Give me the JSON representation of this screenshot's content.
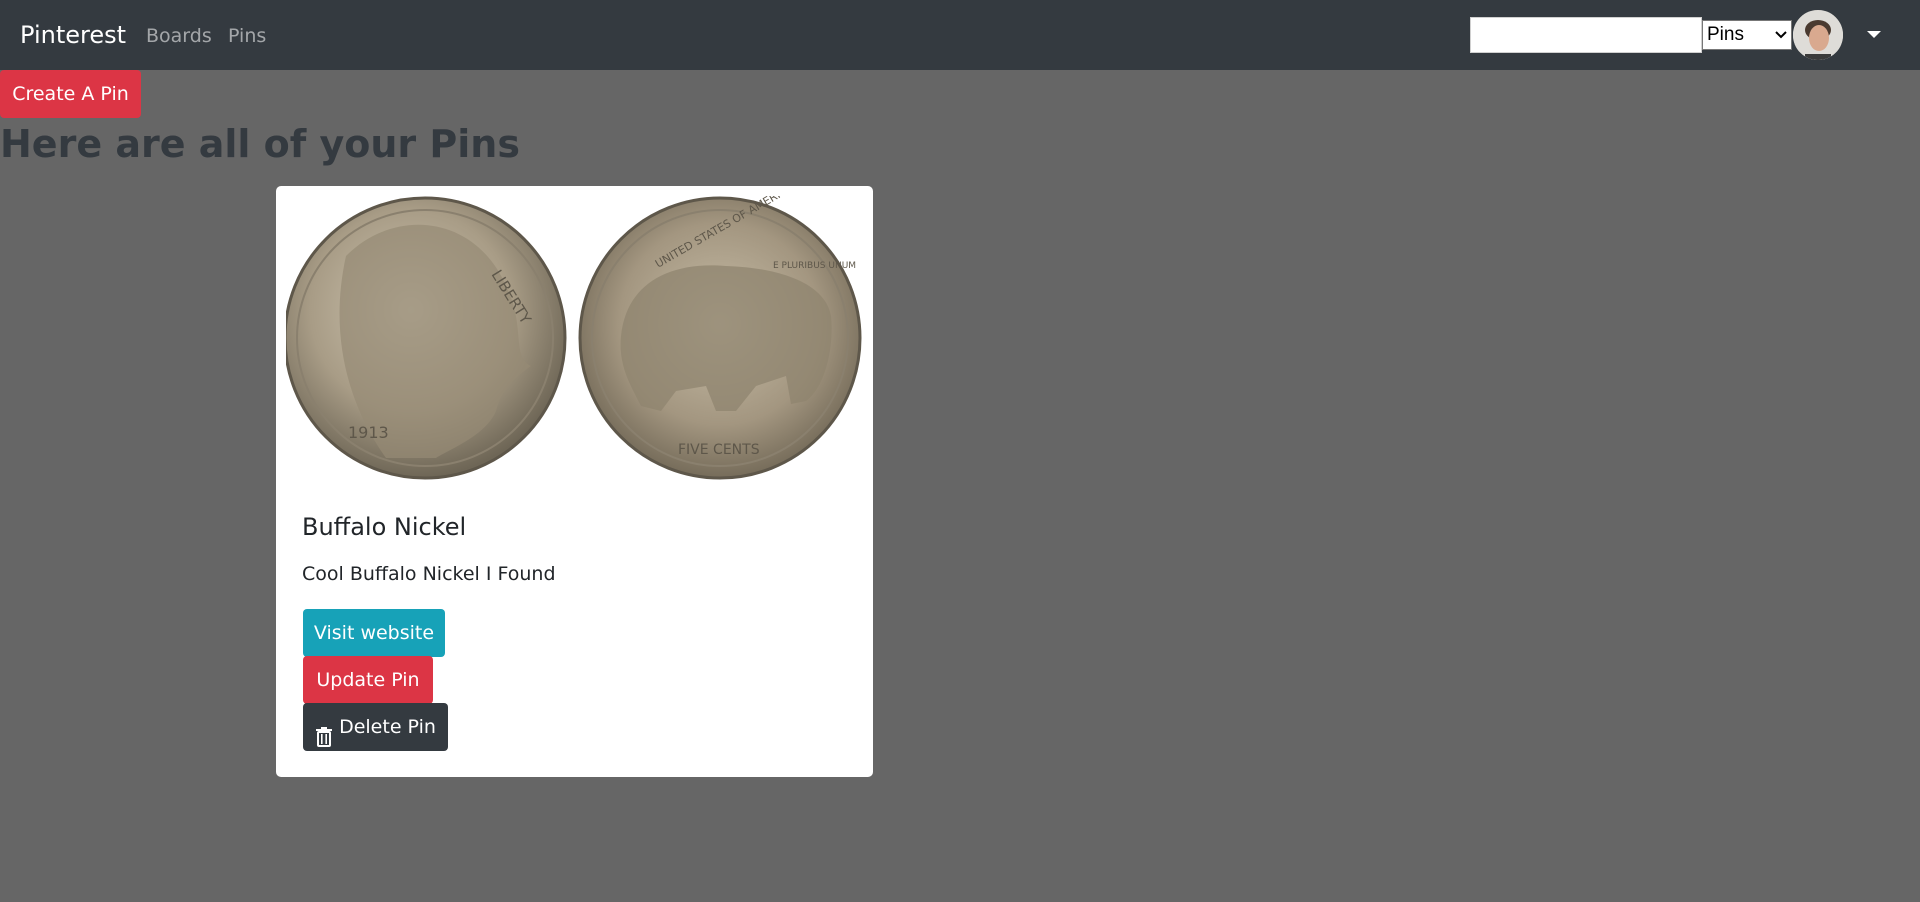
{
  "navbar": {
    "brand": "Pinterest",
    "links": [
      {
        "label": "Boards"
      },
      {
        "label": "Pins"
      }
    ],
    "search": {
      "value": "",
      "placeholder": ""
    },
    "search_type": {
      "selected": "Pins",
      "icon": "chevron-down-icon"
    },
    "user_icon": "avatar",
    "dropdown_icon": "caret-down-icon"
  },
  "page": {
    "create_button": "Create A Pin",
    "title": "Here are all of your Pins"
  },
  "pins": [
    {
      "title": "Buffalo Nickel",
      "description": "Cool Buffalo Nickel I Found",
      "visit_label": "Visit website",
      "update_label": "Update Pin",
      "delete_label": "Delete Pin",
      "delete_icon": "trash-icon",
      "image_text": {
        "obverse_word": "LIBERTY",
        "obverse_year": "1913",
        "reverse_top": "UNITED STATES OF AMERICA",
        "reverse_motto": "E PLURIBUS UNUM",
        "reverse_bottom": "FIVE CENTS"
      }
    }
  ],
  "colors": {
    "navbar": "#343a40",
    "background": "#666666",
    "danger": "#dc3545",
    "info": "#17a2b8",
    "dark": "#343a40"
  }
}
